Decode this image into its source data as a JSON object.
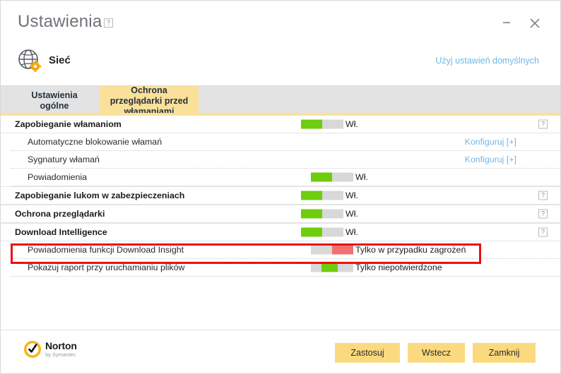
{
  "window": {
    "title": "Ustawienia",
    "help_icon": "?",
    "minimize_icon": "minimize",
    "close_icon": "close"
  },
  "section_header": {
    "icon": "globe-settings-icon",
    "label": "Sieć",
    "defaults_link": "Użyj ustawień domyślnych"
  },
  "tabs": [
    {
      "label": "Ustawienia ogólne",
      "active": false
    },
    {
      "label": "Ochrona przeglądarki przed włamaniami",
      "active": true
    }
  ],
  "rows": [
    {
      "type": "section",
      "label": "Zapobieganie włamaniom",
      "toggle": "on",
      "state": "Wł.",
      "help": "?"
    },
    {
      "type": "sub",
      "label": "Automatyczne blokowanie włamań",
      "config_link": "Konfiguruj [+]"
    },
    {
      "type": "sub",
      "label": "Sygnatury włamań",
      "config_link": "Konfiguruj [+]"
    },
    {
      "type": "sub",
      "label": "Powiadomienia",
      "toggle": "on",
      "state": "Wł."
    },
    {
      "type": "section",
      "label": "Zapobieganie lukom w zabezpieczeniach",
      "toggle": "on",
      "state": "Wł.",
      "help": "?"
    },
    {
      "type": "section",
      "label": "Ochrona przeglądarki",
      "toggle": "on",
      "state": "Wł.",
      "help": "?"
    },
    {
      "type": "section",
      "label": "Download Intelligence",
      "toggle": "on",
      "state": "Wł.",
      "help": "?"
    },
    {
      "type": "sub",
      "label": "Powiadomienia funkcji Download Insight",
      "toggle": "off",
      "state": "Tylko w przypadku zagrożeń",
      "highlighted": true
    },
    {
      "type": "sub",
      "label": "Pokazuj raport przy uruchamianiu plików",
      "toggle": "mid",
      "state": "Tylko niepotwierdzone"
    }
  ],
  "footer": {
    "logo_name": "Norton",
    "logo_sub": "by Symantec",
    "buttons": [
      {
        "label": "Zastosuj"
      },
      {
        "label": "Wstecz"
      },
      {
        "label": "Zamknij"
      }
    ]
  },
  "colors": {
    "accent_yellow": "#fbd97f",
    "tab_active": "#fbe09a",
    "link_blue": "#6fb7e8",
    "toggle_on": "#6ecd0d",
    "toggle_off": "#f07070",
    "highlight_red": "#e81111"
  }
}
